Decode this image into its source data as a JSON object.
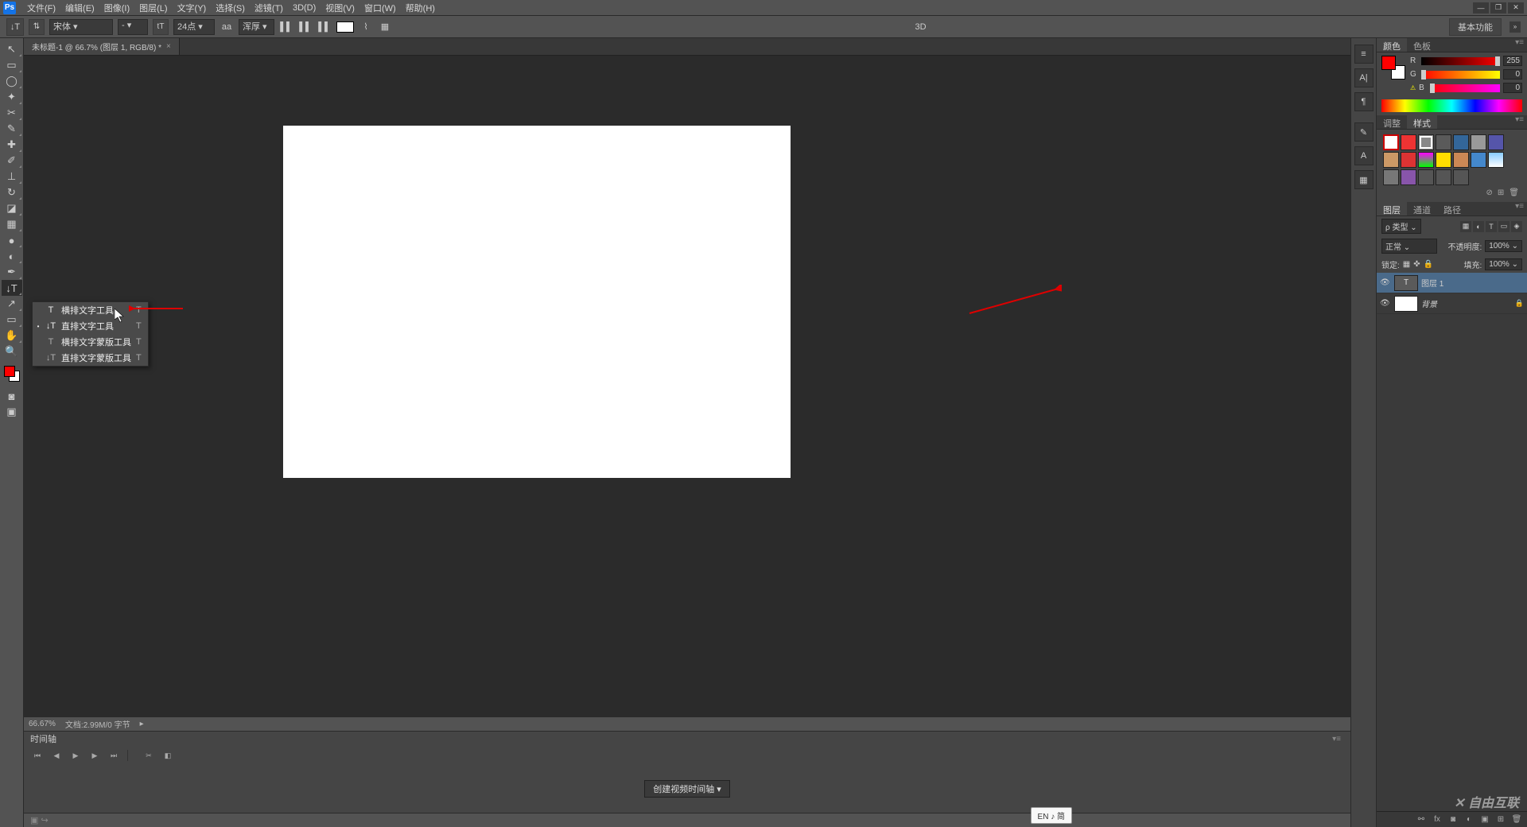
{
  "menubar": {
    "items": [
      "文件(F)",
      "编辑(E)",
      "图像(I)",
      "图层(L)",
      "文字(Y)",
      "选择(S)",
      "滤镜(T)",
      "3D(D)",
      "视图(V)",
      "窗口(W)",
      "帮助(H)"
    ]
  },
  "optionbar": {
    "font_family": "宋体",
    "font_weight": "-",
    "font_size": "24点",
    "aa_label": "aa",
    "anti_alias": "浑厚",
    "center_label": "3D",
    "right_button": "基本功能"
  },
  "document": {
    "tab_label": "未标题-1 @ 66.7% (图层 1, RGB/8) *",
    "zoom": "66.67%",
    "doc_info": "文档:2.99M/0 字节"
  },
  "tool_flyout": {
    "items": [
      {
        "bullet": "",
        "label": "横排文字工具",
        "shortcut": "T"
      },
      {
        "bullet": "•",
        "label": "直排文字工具",
        "shortcut": "T"
      },
      {
        "bullet": "",
        "label": "横排文字蒙版工具",
        "shortcut": "T"
      },
      {
        "bullet": "",
        "label": "直排文字蒙版工具",
        "shortcut": "T"
      }
    ]
  },
  "color_panel": {
    "tabs": [
      "颜色",
      "色板"
    ],
    "r": {
      "label": "R",
      "value": "255"
    },
    "g": {
      "label": "G",
      "value": "0"
    },
    "b": {
      "label": "B",
      "value": "0"
    },
    "warning_icon": "⚠"
  },
  "adjust_panel": {
    "tabs": [
      "调整",
      "样式"
    ]
  },
  "layers_panel": {
    "tabs": [
      "图层",
      "通道",
      "路径"
    ],
    "kind_label": "ρ 类型",
    "blend_mode": "正常",
    "opacity_label": "不透明度:",
    "opacity_value": "100%",
    "lock_label": "锁定:",
    "fill_label": "填充:",
    "fill_value": "100%",
    "layers": [
      {
        "type": "T",
        "name": "图层 1",
        "selected": true
      },
      {
        "type": "img",
        "name": "背景",
        "locked": true,
        "italic": true
      }
    ]
  },
  "timeline": {
    "title": "时间轴",
    "create_button": "创建视频时间轴"
  },
  "ime": "EN ♪ 简",
  "watermark": "✕ 自由互联"
}
